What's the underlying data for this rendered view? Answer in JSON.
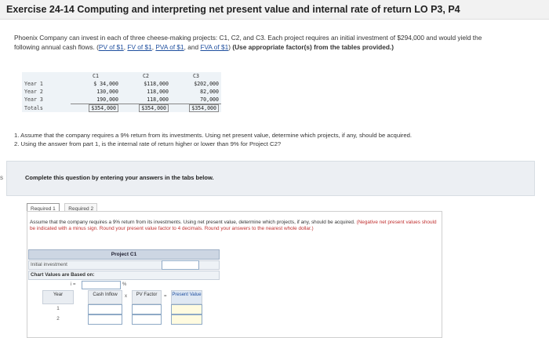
{
  "title": "Exercise 24-14 Computing and interpreting net present value and internal rate of return LO P3, P4",
  "intro": {
    "text1": "Phoenix Company can invest in each of three cheese-making projects: C1, C2, and C3. Each project requires an initial investment of $294,000 and would yield the following annual cash flows. (",
    "links": [
      "PV of $1",
      "FV of $1",
      "PVA of $1",
      "FVA of $1"
    ],
    "text2": ") ",
    "bold": "(Use appropriate factor(s) from the tables provided.)"
  },
  "data_table": {
    "headers": [
      "",
      "C1",
      "C2",
      "C3"
    ],
    "rows": [
      {
        "label": "Year 1",
        "values": [
          "$ 34,000",
          "$118,000",
          "$202,000"
        ]
      },
      {
        "label": "Year 2",
        "values": [
          "130,000",
          "118,000",
          "82,000"
        ]
      },
      {
        "label": "Year 3",
        "values": [
          "190,000",
          "118,000",
          "70,000"
        ]
      },
      {
        "label": "Totals",
        "values": [
          "$354,000",
          "$354,000",
          "$354,000"
        ]
      }
    ]
  },
  "questions": {
    "q1": "1. Assume that the company requires a 9% return from its investments. Using net present value, determine which projects, if any, should be acquired.",
    "q2": "2. Using the answer from part 1, is the internal rate of return higher or lower than 9% for Project C2?"
  },
  "complete_text": "Complete this question by entering your answers in the tabs below.",
  "side_mark": "s",
  "tabs": [
    "Required 1",
    "Required 2"
  ],
  "instructions": {
    "main": "Assume that the company requires a 9% return from its investments. Using net present value, determine which projects, if any, should be acquired.",
    "hint": "(Negative net present values should be indicated with a minus sign. Round your present value factor to 4 decimals. Round your answers to the nearest whole dollar.)"
  },
  "grid": {
    "project_label": "Project C1",
    "initial_investment": "Initial investment",
    "chart_values": "Chart Values are Based on:",
    "i_label": "i =",
    "percent": "%",
    "col_year": "Year",
    "col_cash": "Cash Inflow",
    "op_times": "x",
    "col_pv": "PV Factor",
    "op_eq": "=",
    "col_present": "Present Value",
    "years": [
      "1",
      "2"
    ]
  }
}
